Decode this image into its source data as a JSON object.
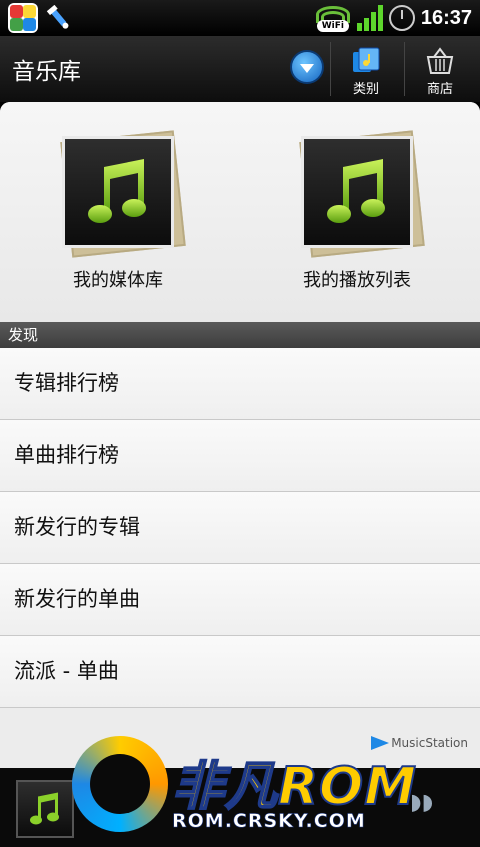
{
  "status_bar": {
    "wifi_label": "WiFi",
    "time": "16:37"
  },
  "header": {
    "title": "音乐库",
    "category_label": "类别",
    "store_label": "商店"
  },
  "library": {
    "tiles": [
      {
        "label": "我的媒体库"
      },
      {
        "label": "我的播放列表"
      }
    ]
  },
  "discover": {
    "header": "发现",
    "items": [
      {
        "label": "专辑排行榜"
      },
      {
        "label": "单曲排行榜"
      },
      {
        "label": "新发行的专辑"
      },
      {
        "label": "新发行的单曲"
      },
      {
        "label": "流派 - 单曲"
      }
    ]
  },
  "brand": {
    "music_station": "MusicStation"
  },
  "watermark": {
    "title": "非凡ROM",
    "url": "ROM.CRSKY.COM"
  },
  "colors": {
    "accent_blue": "#1565c0",
    "note_green": "#8bd12a",
    "signal_green": "#5dd62c"
  }
}
